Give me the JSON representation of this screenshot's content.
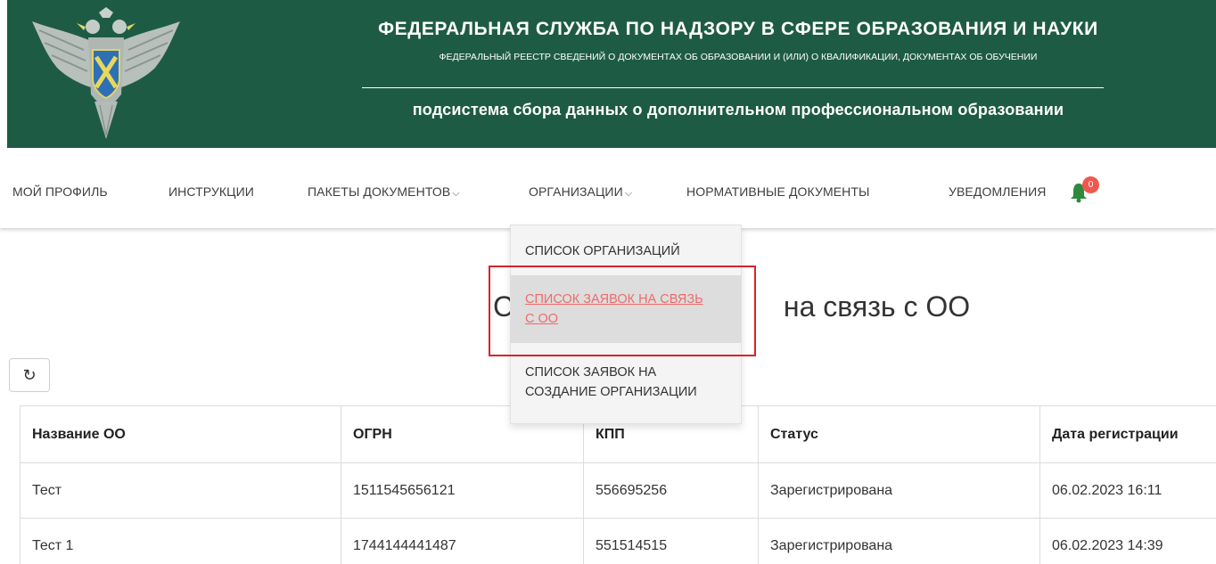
{
  "header": {
    "agency_title": "ФЕДЕРАЛЬНАЯ СЛУЖБА ПО НАДЗОРУ В СФЕРЕ ОБРАЗОВАНИЯ И НАУКИ",
    "registry_subtitle": "ФЕДЕРАЛЬНЫЙ РЕЕСТР СВЕДЕНИЙ О ДОКУМЕНТАХ ОБ ОБРАЗОВАНИИ И (ИЛИ) О КВАЛИФИКАЦИИ, ДОКУМЕНТАХ ОБ ОБУЧЕНИИ",
    "subsystem": "подсистема сбора данных о дополнительном профессиональном образовании",
    "background_color": "#1e5b45"
  },
  "nav": {
    "items": [
      {
        "label": "МОЙ ПРОФИЛЬ"
      },
      {
        "label": "ИНСТРУКЦИИ"
      },
      {
        "label": "ПАКЕТЫ ДОКУМЕНТОВ"
      },
      {
        "label": "ОРГАНИЗАЦИИ"
      },
      {
        "label": "НОРМАТИВНЫЕ ДОКУМЕНТЫ"
      },
      {
        "label": "УВЕДОМЛЕНИЯ"
      }
    ],
    "chevron": "⌵",
    "notification_count": "0",
    "badge_color": "#f0584f"
  },
  "dropdown": {
    "items": [
      {
        "label": "СПИСОК ОРГАНИЗАЦИЙ"
      },
      {
        "line1": "СПИСОК ЗАЯВОК НА СВЯЗЬ",
        "line2": "С ОО",
        "active": true
      },
      {
        "line1": "СПИСОК ЗАЯВОК НА",
        "line2": "СОЗДАНИЕ ОРГАНИЗАЦИИ"
      }
    ],
    "active_color": "#f06a6a",
    "highlight_color": "#d9222b"
  },
  "page": {
    "title_left": "С",
    "title_right": "на связь с ОО",
    "refresh_icon": "↻"
  },
  "table": {
    "columns": [
      "Название ОО",
      "ОГРН",
      "КПП",
      "Статус",
      "Дата регистрации"
    ],
    "rows": [
      [
        "Тест",
        "1511545656121",
        "556695256",
        "Зарегистрирована",
        "06.02.2023 16:11"
      ],
      [
        "Тест 1",
        "1744144441487",
        "551514515",
        "Зарегистрирована",
        "06.02.2023 14:39"
      ]
    ]
  }
}
